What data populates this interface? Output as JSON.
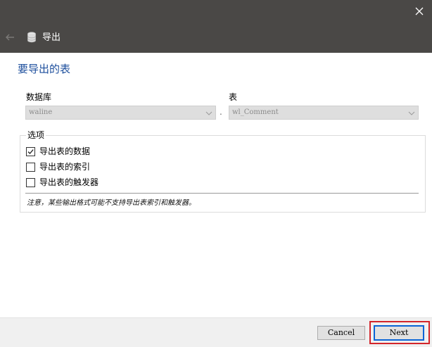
{
  "titlebar": {
    "title": "导出",
    "icons": {
      "close": "close-icon",
      "back": "back-arrow-icon",
      "database": "database-icon"
    }
  },
  "page": {
    "heading": "要导出的表",
    "database_label": "数据库",
    "database_value": "waline",
    "table_label": "表",
    "table_value": "wl_Comment",
    "separator": "."
  },
  "options": {
    "title": "选项",
    "items": [
      {
        "label": "导出表的数据",
        "checked": true
      },
      {
        "label": "导出表的索引",
        "checked": false
      },
      {
        "label": "导出表的触发器",
        "checked": false
      }
    ],
    "note": "注意，某些输出格式可能不支持导出表索引和触发器。"
  },
  "footer": {
    "cancel_label": "Cancel",
    "next_label": "Next"
  },
  "colors": {
    "titlebar": "#4a4846",
    "heading": "#1c4e9c",
    "highlight": "#d3252b",
    "focus": "#0a64d6"
  }
}
